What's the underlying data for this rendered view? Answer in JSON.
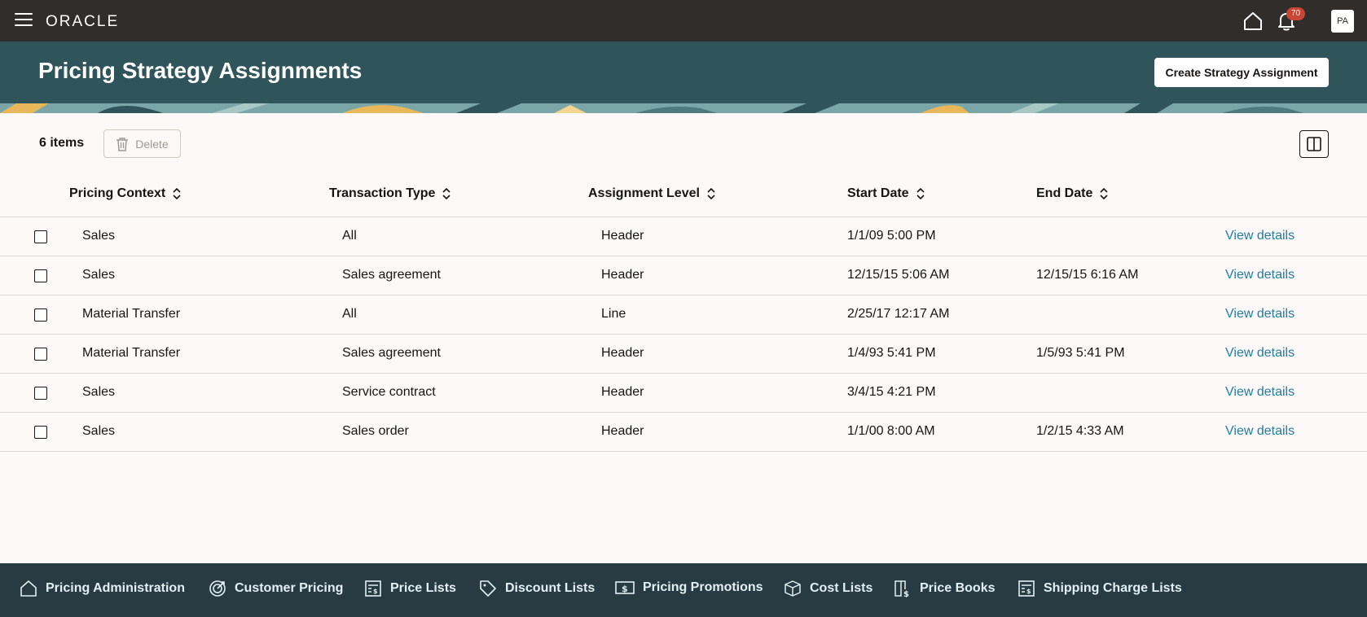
{
  "topbar": {
    "logo": "ORACLE",
    "notification_count": "70",
    "avatar_initials": "PA"
  },
  "header": {
    "title": "Pricing Strategy Assignments",
    "create_button": "Create Strategy Assignment"
  },
  "toolbar": {
    "items_count": "6 items",
    "delete_label": "Delete"
  },
  "table": {
    "columns": [
      "Pricing Context",
      "Transaction Type",
      "Assignment Level",
      "Start Date",
      "End Date"
    ],
    "link_label": "View details",
    "rows": [
      {
        "context": "Sales",
        "type": "All",
        "level": "Header",
        "start": "1/1/09 5:00 PM",
        "end": ""
      },
      {
        "context": "Sales",
        "type": "Sales agreement",
        "level": "Header",
        "start": "12/15/15 5:06 AM",
        "end": "12/15/15 6:16 AM"
      },
      {
        "context": "Material Transfer",
        "type": "All",
        "level": "Line",
        "start": "2/25/17 12:17 AM",
        "end": ""
      },
      {
        "context": "Material Transfer",
        "type": "Sales agreement",
        "level": "Header",
        "start": "1/4/93 5:41 PM",
        "end": "1/5/93 5:41 PM"
      },
      {
        "context": "Sales",
        "type": "Service contract",
        "level": "Header",
        "start": "3/4/15 4:21 PM",
        "end": ""
      },
      {
        "context": "Sales",
        "type": "Sales order",
        "level": "Header",
        "start": "1/1/00 8:00 AM",
        "end": "1/2/15 4:33 AM"
      }
    ]
  },
  "footer_nav": [
    {
      "label": "Pricing Administration",
      "icon": "home-icon"
    },
    {
      "label": "Customer Pricing",
      "icon": "target-icon"
    },
    {
      "label": "Price Lists",
      "icon": "price-list-icon"
    },
    {
      "label": "Discount Lists",
      "icon": "tag-icon"
    },
    {
      "label": "Pricing Promotions",
      "icon": "dollar-bill-icon"
    },
    {
      "label": "Cost Lists",
      "icon": "cost-box-icon"
    },
    {
      "label": "Price Books",
      "icon": "price-book-icon"
    },
    {
      "label": "Shipping Charge Lists",
      "icon": "shipping-list-icon"
    }
  ],
  "colors": {
    "topbar": "#312d2a",
    "header": "#2f555b",
    "footer": "#283b42",
    "link": "#227e9e",
    "badge": "#c74634"
  }
}
